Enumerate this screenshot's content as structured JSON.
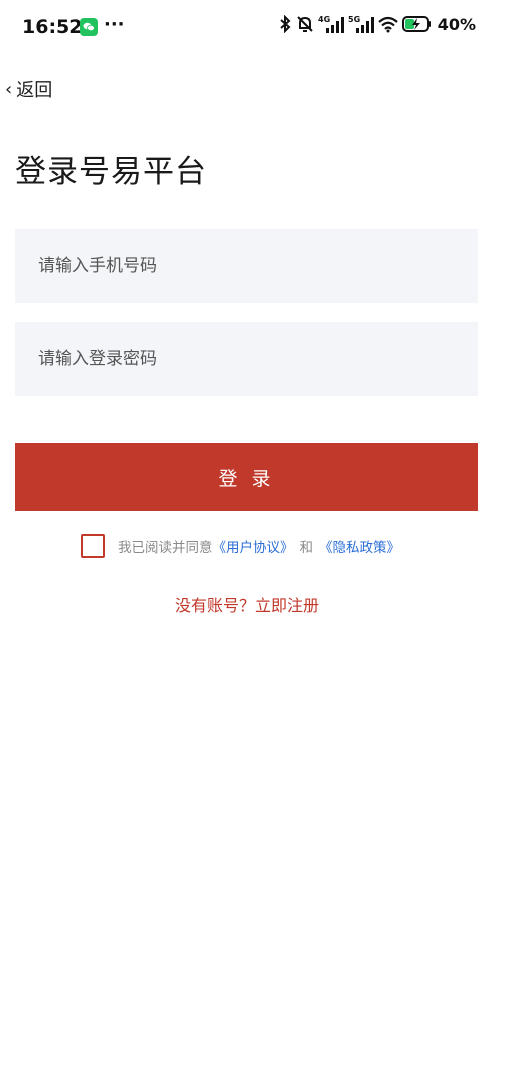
{
  "status_bar": {
    "time": "16:52",
    "more": "···",
    "signal_4g": "4G",
    "signal_5g": "5G",
    "battery": "40%",
    "icons": [
      "wechat-icon",
      "bluetooth-icon",
      "mute-bell-icon",
      "signal-4g-icon",
      "signal-5g-icon",
      "wifi-icon",
      "battery-charging-icon"
    ]
  },
  "nav": {
    "back_label": "返回"
  },
  "header": {
    "title": "登录号易平台"
  },
  "form": {
    "phone_placeholder": "请输入手机号码",
    "password_placeholder": "请输入登录密码",
    "login_label": "登 录"
  },
  "agreement": {
    "prefix": "我已阅读并同意",
    "user_agreement": "《用户协议》",
    "and": "和",
    "privacy_policy": "《隐私政策》"
  },
  "register": {
    "label": "没有账号？立即注册"
  },
  "colors": {
    "accent": "#c0392b",
    "link": "#2b6fd6",
    "input_bg": "#f4f5f9"
  }
}
